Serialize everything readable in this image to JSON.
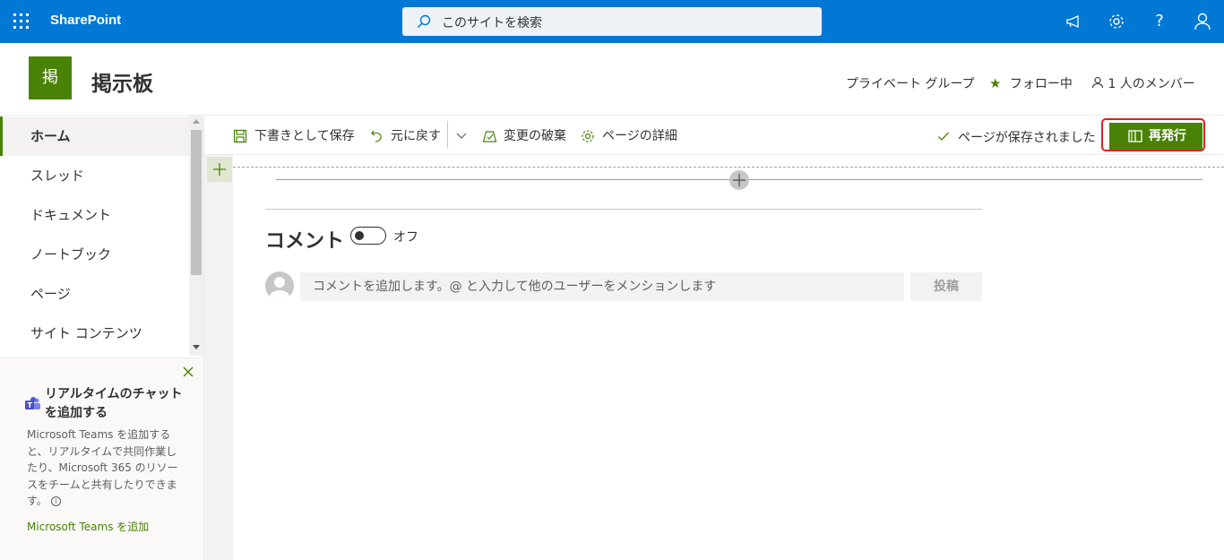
{
  "topbar": {
    "app_name": "SharePoint",
    "search_placeholder": "このサイトを検索",
    "icons": [
      "waffle-icon",
      "megaphone-icon",
      "gear-icon",
      "help-icon",
      "person-icon"
    ]
  },
  "site": {
    "logo_char": "掲",
    "title": "掲示板",
    "privacy": "プライベート グループ",
    "follow_label": "フォロー中",
    "members_label": "1 人のメンバー",
    "accent_color": "#498205"
  },
  "nav": {
    "items": [
      {
        "label": "ホーム",
        "active": true
      },
      {
        "label": "スレッド"
      },
      {
        "label": "ドキュメント"
      },
      {
        "label": "ノートブック"
      },
      {
        "label": "ページ"
      },
      {
        "label": "サイト コンテンツ"
      }
    ]
  },
  "teams_panel": {
    "title": "リアルタイムのチャットを追加する",
    "description": "Microsoft Teams を追加すると、リアルタイムで共同作業したり、Microsoft 365 のリソースをチームと共有したりできます。",
    "link": "Microsoft Teams を追加"
  },
  "commandbar": {
    "save_draft": "下書きとして保存",
    "undo": "元に戻す",
    "discard": "変更の破棄",
    "page_details": "ページの詳細",
    "saved_status": "ページが保存されました",
    "republish": "再発行"
  },
  "comments": {
    "title": "コメント",
    "toggle_label": "オフ",
    "toggle_on": false,
    "input_placeholder": "コメントを追加します。@ と入力して他のユーザーをメンションします",
    "post_label": "投稿"
  }
}
